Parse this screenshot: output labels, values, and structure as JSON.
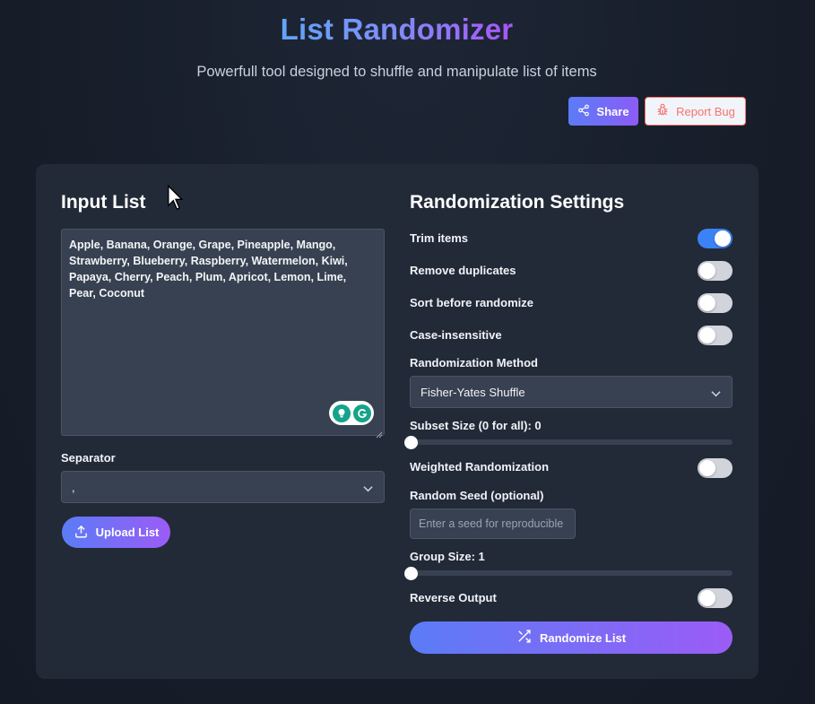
{
  "header": {
    "title": "List Randomizer",
    "subtitle": "Powerfull tool designed to shuffle and manipulate list of items",
    "share_label": "Share",
    "share_icon": "share-icon",
    "report_label": "Report Bug",
    "report_icon": "bug-icon"
  },
  "input": {
    "heading": "Input List",
    "text": "Apple, Banana, Orange, Grape, Pineapple, Mango,\nStrawberry, Blueberry, Raspberry, Watermelon, Kiwi,\nPapaya, Cherry, Peach, Plum, Apricot, Lemon, Lime,\nPear, Coconut",
    "separator_label": "Separator",
    "separator_value": ",",
    "upload_label": "Upload List"
  },
  "settings": {
    "heading": "Randomization Settings",
    "trim_label": "Trim items",
    "trim_on": true,
    "dedupe_label": "Remove duplicates",
    "dedupe_on": false,
    "sort_label": "Sort before randomize",
    "sort_on": false,
    "case_label": "Case-insensitive",
    "case_on": false,
    "method_label": "Randomization Method",
    "method_value": "Fisher-Yates Shuffle",
    "subset_label": "Subset Size (0 for all): 0",
    "subset_value": 0,
    "weighted_label": "Weighted Randomization",
    "weighted_on": false,
    "seed_label": "Random Seed (optional)",
    "seed_placeholder": "Enter a seed for reproducible",
    "group_label": "Group Size: 1",
    "group_value": 1,
    "reverse_label": "Reverse Output",
    "reverse_on": false,
    "randomize_label": "Randomize List",
    "randomize_icon": "shuffle-icon"
  },
  "colors": {
    "accent_start": "#5b7cf6",
    "accent_end": "#9b5cf6",
    "toggle_on": "#3b82f6",
    "bug_red": "#f87171"
  }
}
